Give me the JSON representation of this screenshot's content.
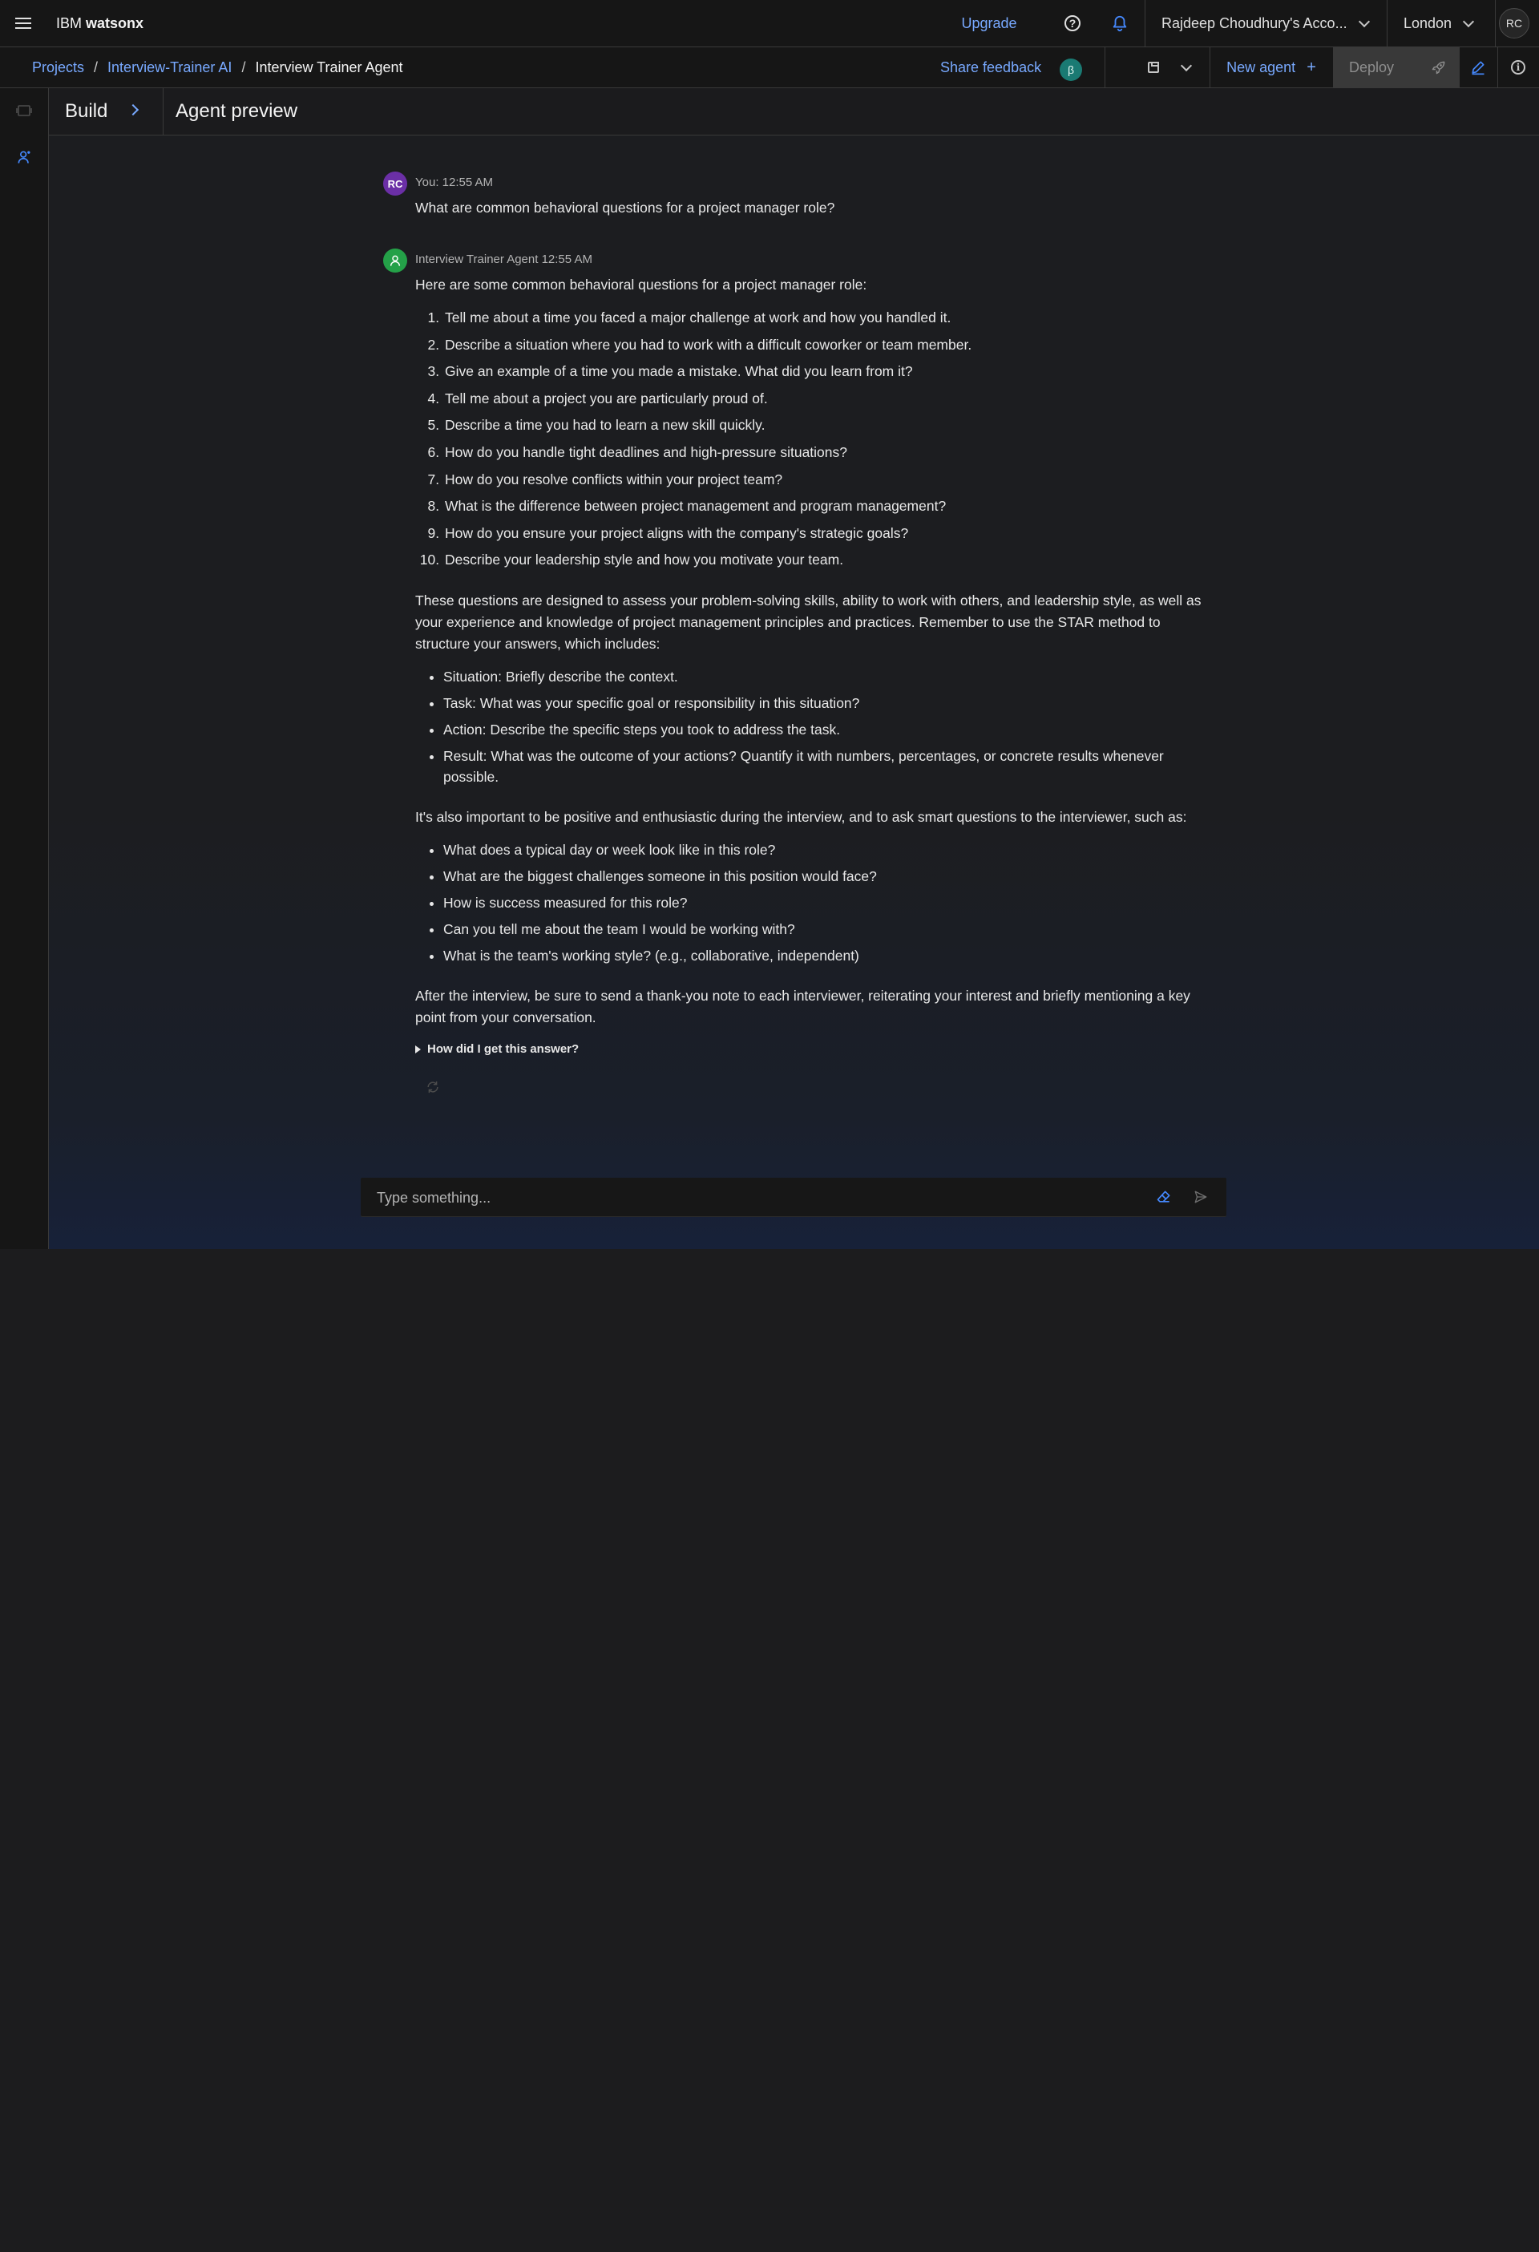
{
  "header": {
    "brand_prefix": "IBM",
    "brand_name": "watsonx",
    "upgrade_label": "Upgrade",
    "account_label": "Rajdeep Choudhury's Acco...",
    "region_label": "London",
    "avatar_initials": "RC"
  },
  "breadcrumb": {
    "items": [
      "Projects",
      "Interview-Trainer AI"
    ],
    "separator": "/",
    "current": "Interview Trainer Agent"
  },
  "toolbar": {
    "share_feedback": "Share feedback",
    "beta_badge": "β",
    "new_agent": "New agent",
    "new_agent_icon": "+",
    "deploy": "Deploy"
  },
  "panels": {
    "build_title": "Build",
    "preview_title": "Agent preview"
  },
  "chat": {
    "user_message": {
      "avatar": "RC",
      "meta": "You: 12:55 AM",
      "text": "What are common behavioral questions for a project manager role?"
    },
    "agent_message": {
      "meta": "Interview Trainer Agent 12:55 AM",
      "intro": "Here are some common behavioral questions for a project manager role:",
      "questions": [
        "Tell me about a time you faced a major challenge at work and how you handled it.",
        "Describe a situation where you had to work with a difficult coworker or team member.",
        "Give an example of a time you made a mistake. What did you learn from it?",
        "Tell me about a project you are particularly proud of.",
        "Describe a time you had to learn a new skill quickly.",
        "How do you handle tight deadlines and high-pressure situations?",
        "How do you resolve conflicts within your project team?",
        "What is the difference between project management and program management?",
        "How do you ensure your project aligns with the company's strategic goals?",
        "Describe your leadership style and how you motivate your team."
      ],
      "paragraph_star": "These questions are designed to assess your problem-solving skills, ability to work with others, and leadership style, as well as your experience and knowledge of project management principles and practices. Remember to use the STAR method to structure your answers, which includes:",
      "star_items": [
        "Situation: Briefly describe the context.",
        "Task: What was your specific goal or responsibility in this situation?",
        "Action: Describe the specific steps you took to address the task.",
        "Result: What was the outcome of your actions? Quantify it with numbers, percentages, or concrete results whenever possible."
      ],
      "paragraph_questions": "It's also important to be positive and enthusiastic during the interview, and to ask smart questions to the interviewer, such as:",
      "ask_items": [
        "What does a typical day or week look like in this role?",
        "What are the biggest challenges someone in this position would face?",
        "How is success measured for this role?",
        "Can you tell me about the team I would be working with?",
        "What is the team's working style? (e.g., collaborative, independent)"
      ],
      "paragraph_closing": "After the interview, be sure to send a thank-you note to each interviewer, reiterating your interest and briefly mentioning a key point from your conversation.",
      "how_label": "How did I get this answer?"
    },
    "input": {
      "placeholder": "Type something..."
    }
  },
  "colors": {
    "link": "#78a9ff",
    "user_avatar": "#6b2fa6",
    "agent_avatar": "#24a148",
    "beta_badge": "#1a7a73"
  },
  "icons": {
    "menu": "hamburger-icon",
    "help": "help-icon",
    "notifications": "bell-icon",
    "save": "save-icon",
    "deploy": "rocket-icon",
    "edit": "pencil-icon",
    "info": "info-icon",
    "rail_top": "toggle-icon",
    "rail_agent": "agent-icon",
    "regenerate": "regenerate-icon",
    "clear": "eraser-icon",
    "send": "send-icon"
  }
}
